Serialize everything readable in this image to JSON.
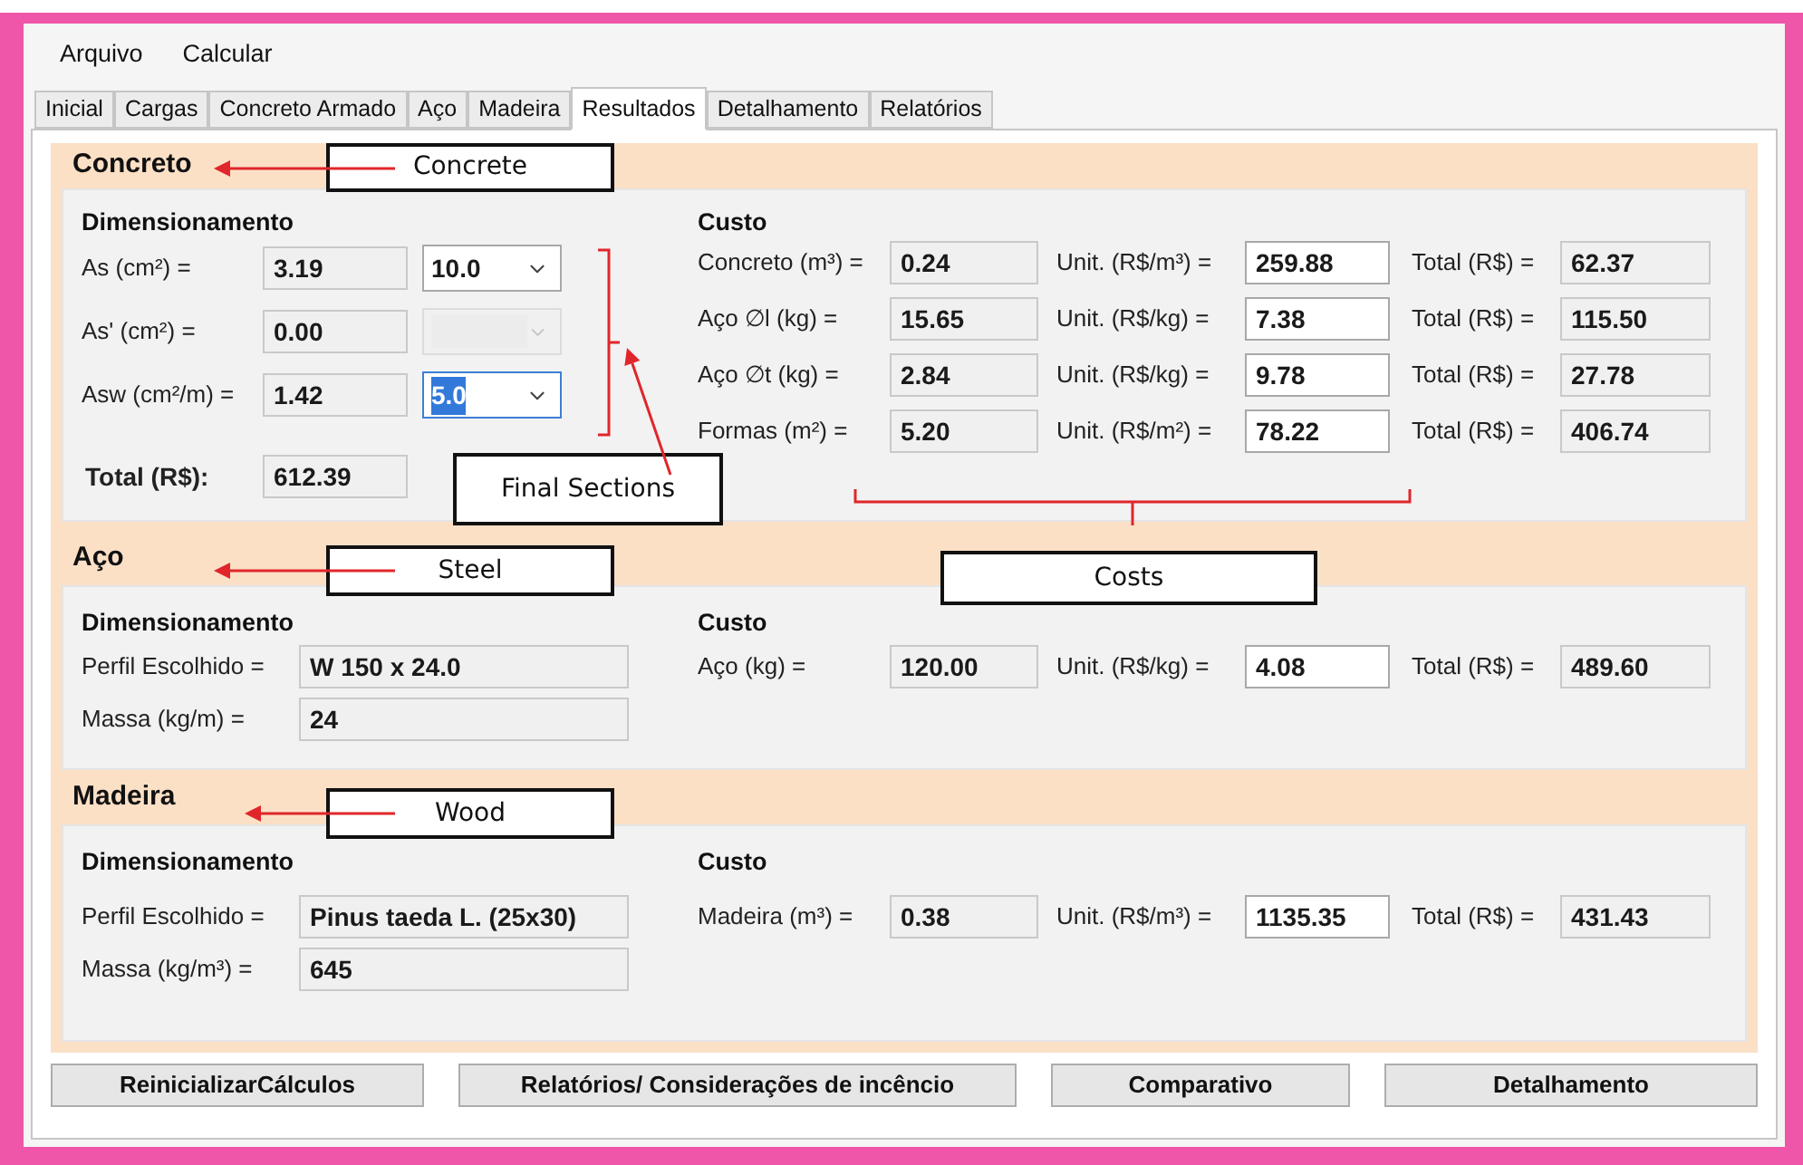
{
  "menu": [
    "Arquivo",
    "Calcular"
  ],
  "tabs": [
    {
      "label": "Inicial",
      "selected": false
    },
    {
      "label": "Cargas",
      "selected": false
    },
    {
      "label": "Concreto Armado",
      "selected": false
    },
    {
      "label": "Aço",
      "selected": false
    },
    {
      "label": "Madeira",
      "selected": false
    },
    {
      "label": "Resultados",
      "selected": true
    },
    {
      "label": "Detalhamento",
      "selected": false
    },
    {
      "label": "Relatórios",
      "selected": false
    }
  ],
  "concrete": {
    "title": "Concreto",
    "dimensioning": {
      "heading": "Dimensionamento",
      "rows": [
        {
          "label": "As (cm²) =",
          "value": "3.19",
          "select": {
            "value": "10.0",
            "disabled": false,
            "focused": false
          }
        },
        {
          "label": "As' (cm²) =",
          "value": "0.00",
          "select": {
            "disabled": true,
            "focused": false
          }
        },
        {
          "label": "Asw (cm²/m) =",
          "value": "1.42",
          "select": {
            "value": "5.0",
            "disabled": false,
            "focused": true
          }
        }
      ],
      "total": {
        "label": "Total (R$):",
        "value": "612.39"
      }
    },
    "cost": {
      "heading": "Custo",
      "rows": [
        {
          "label": "Concreto (m³) =",
          "quantity": "0.24",
          "unit_label": "Unit. (R$/m³) =",
          "unit_value": "259.88",
          "total_label": "Total (R$) =",
          "total_value": "62.37"
        },
        {
          "label": "Aço ∅l (kg) =",
          "quantity": "15.65",
          "unit_label": "Unit. (R$/kg) =",
          "unit_value": "7.38",
          "total_label": "Total (R$) =",
          "total_value": "115.50"
        },
        {
          "label": "Aço ∅t (kg) =",
          "quantity": "2.84",
          "unit_label": "Unit. (R$/kg) =",
          "unit_value": "9.78",
          "total_label": "Total (R$) =",
          "total_value": "27.78"
        },
        {
          "label": "Formas (m²) =",
          "quantity": "5.20",
          "unit_label": "Unit. (R$/m²) =",
          "unit_value": "78.22",
          "total_label": "Total (R$) =",
          "total_value": "406.74"
        }
      ]
    }
  },
  "steel": {
    "title": "Aço",
    "dimensioning": {
      "heading": "Dimensionamento",
      "rows": [
        {
          "label": "Perfil Escolhido =",
          "value": "W 150 x 24.0"
        },
        {
          "label": "Massa (kg/m) =",
          "value": "24"
        }
      ]
    },
    "cost": {
      "heading": "Custo",
      "rows": [
        {
          "label": "Aço (kg) =",
          "quantity": "120.00",
          "unit_label": "Unit. (R$/kg) =",
          "unit_value": "4.08",
          "total_label": "Total (R$) =",
          "total_value": "489.60"
        }
      ]
    }
  },
  "wood": {
    "title": "Madeira",
    "dimensioning": {
      "heading": "Dimensionamento",
      "rows": [
        {
          "label": "Perfil Escolhido =",
          "value": "Pinus taeda L. (25x30)"
        },
        {
          "label": "Massa (kg/m³) =",
          "value": "645"
        }
      ]
    },
    "cost": {
      "heading": "Custo",
      "rows": [
        {
          "label": "Madeira (m³) =",
          "quantity": "0.38",
          "unit_label": "Unit. (R$/m³) =",
          "unit_value": "1135.35",
          "total_label": "Total (R$) =",
          "total_value": "431.43"
        }
      ]
    }
  },
  "buttons": [
    "ReinicializarCálculos",
    "Relatórios/ Considerações de incêncio",
    "Comparativo",
    "Detalhamento"
  ],
  "annotations": [
    "Concrete",
    "Final Sections",
    "Steel",
    "Costs",
    "Wood"
  ]
}
